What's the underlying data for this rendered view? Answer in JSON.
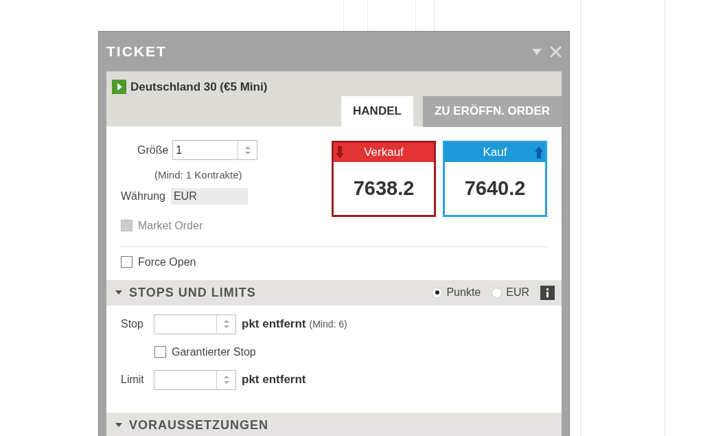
{
  "window": {
    "title": "TICKET"
  },
  "instrument": {
    "name": "Deutschland 30 (€5 Mini)"
  },
  "tabs": [
    {
      "label": "HANDEL",
      "selected": true
    },
    {
      "label": "ZU ERÖFFN. ORDER",
      "selected": false
    }
  ],
  "size": {
    "label": "Größe",
    "value": "1",
    "hint": "(Mind: 1 Kontrakte)"
  },
  "currency": {
    "label": "Währung",
    "value": "EUR"
  },
  "prices": [
    {
      "kind": "sell",
      "label": "Verkauf",
      "value": "7638.2",
      "selected": true
    },
    {
      "kind": "buy",
      "label": "Kauf",
      "value": "7640.2",
      "selected": false
    }
  ],
  "options": [
    {
      "label": "Market Order",
      "checked": false,
      "disabled": true
    },
    {
      "label": "Force Open",
      "checked": false,
      "disabled": false
    }
  ],
  "stops_section": {
    "title": "STOPS UND LIMITS",
    "units": [
      {
        "label": "Punkte",
        "selected": true
      },
      {
        "label": "EUR",
        "selected": false
      }
    ],
    "stop": {
      "label": "Stop",
      "unit": "pkt entfernt",
      "hint": "(Mind: 6)"
    },
    "guaranteed": {
      "label": "Garantierter Stop",
      "checked": false
    },
    "limit": {
      "label": "Limit",
      "unit": "pkt entfernt"
    }
  },
  "next_section": {
    "title": "VORAUSSETZUNGEN"
  }
}
